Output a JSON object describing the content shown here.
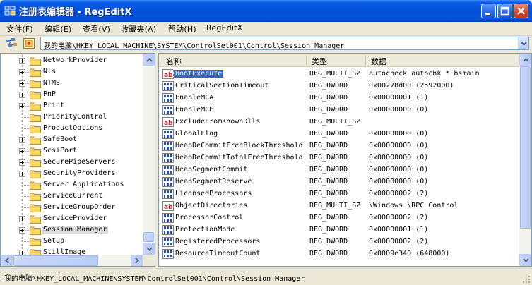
{
  "window": {
    "title": "注册表编辑器 - RegEditX"
  },
  "menu": [
    {
      "label": "文件(F)"
    },
    {
      "label": "编辑(E)"
    },
    {
      "label": "查看(V)"
    },
    {
      "label": "收藏夹(A)"
    },
    {
      "label": "帮助(H)"
    },
    {
      "label": "RegEditX"
    }
  ],
  "address": {
    "path": "我的电脑\\HKEY_LOCAL_MACHINE\\SYSTEM\\ControlSet001\\Control\\Session Manager"
  },
  "tree": {
    "items": [
      {
        "label": "NetworkProvider",
        "expandable": true
      },
      {
        "label": "Nls",
        "expandable": true
      },
      {
        "label": "NTMS",
        "expandable": true
      },
      {
        "label": "PnP",
        "expandable": true
      },
      {
        "label": "Print",
        "expandable": true
      },
      {
        "label": "PriorityControl",
        "expandable": false
      },
      {
        "label": "ProductOptions",
        "expandable": false
      },
      {
        "label": "SafeBoot",
        "expandable": true
      },
      {
        "label": "ScsiPort",
        "expandable": true
      },
      {
        "label": "SecurePipeServers",
        "expandable": true
      },
      {
        "label": "SecurityProviders",
        "expandable": true
      },
      {
        "label": "Server Applications",
        "expandable": false
      },
      {
        "label": "ServiceCurrent",
        "expandable": false
      },
      {
        "label": "ServiceGroupOrder",
        "expandable": false
      },
      {
        "label": "ServiceProvider",
        "expandable": true
      },
      {
        "label": "Session Manager",
        "expandable": true,
        "selected": true
      },
      {
        "label": "Setup",
        "expandable": false
      },
      {
        "label": "StillImage",
        "expandable": true
      }
    ]
  },
  "list": {
    "columns": {
      "name": "名称",
      "type": "类型",
      "data": "数据"
    },
    "rows": [
      {
        "icon": "string-value-icon",
        "name": "BootExecute",
        "type": "REG_MULTI_SZ",
        "data": "autocheck autochk *  bsmain",
        "selected": true
      },
      {
        "icon": "binary-value-icon",
        "name": "CriticalSectionTimeout",
        "type": "REG_DWORD",
        "data": "0x00278d00 (2592000)"
      },
      {
        "icon": "binary-value-icon",
        "name": "EnableMCA",
        "type": "REG_DWORD",
        "data": "0x00000001 (1)"
      },
      {
        "icon": "binary-value-icon",
        "name": "EnableMCE",
        "type": "REG_DWORD",
        "data": "0x00000000 (0)"
      },
      {
        "icon": "string-value-icon",
        "name": "ExcludeFromKnownDlls",
        "type": "REG_MULTI_SZ",
        "data": ""
      },
      {
        "icon": "binary-value-icon",
        "name": "GlobalFlag",
        "type": "REG_DWORD",
        "data": "0x00000000 (0)"
      },
      {
        "icon": "binary-value-icon",
        "name": "HeapDeCommitFreeBlockThreshold",
        "type": "REG_DWORD",
        "data": "0x00000000 (0)"
      },
      {
        "icon": "binary-value-icon",
        "name": "HeapDeCommitTotalFreeThreshold",
        "type": "REG_DWORD",
        "data": "0x00000000 (0)"
      },
      {
        "icon": "binary-value-icon",
        "name": "HeapSegmentCommit",
        "type": "REG_DWORD",
        "data": "0x00000000 (0)"
      },
      {
        "icon": "binary-value-icon",
        "name": "HeapSegmentReserve",
        "type": "REG_DWORD",
        "data": "0x00000000 (0)"
      },
      {
        "icon": "binary-value-icon",
        "name": "LicensedProcessors",
        "type": "REG_DWORD",
        "data": "0x00000002 (2)"
      },
      {
        "icon": "string-value-icon",
        "name": "ObjectDirectories",
        "type": "REG_MULTI_SZ",
        "data": "\\Windows \\RPC Control"
      },
      {
        "icon": "binary-value-icon",
        "name": "ProcessorControl",
        "type": "REG_DWORD",
        "data": "0x00000002 (2)"
      },
      {
        "icon": "binary-value-icon",
        "name": "ProtectionMode",
        "type": "REG_DWORD",
        "data": "0x00000001 (1)"
      },
      {
        "icon": "binary-value-icon",
        "name": "RegisteredProcessors",
        "type": "REG_DWORD",
        "data": "0x00000002 (2)"
      },
      {
        "icon": "binary-value-icon",
        "name": "ResourceTimeoutCount",
        "type": "REG_DWORD",
        "data": "0x0009e340 (648000)"
      }
    ]
  },
  "status": {
    "text": "我的电脑\\HKEY_LOCAL_MACHINE\\SYSTEM\\ControlSet001\\Control\\Session Manager"
  },
  "colors": {
    "titlebar": "#0551d9",
    "selection": "#316ac5"
  }
}
